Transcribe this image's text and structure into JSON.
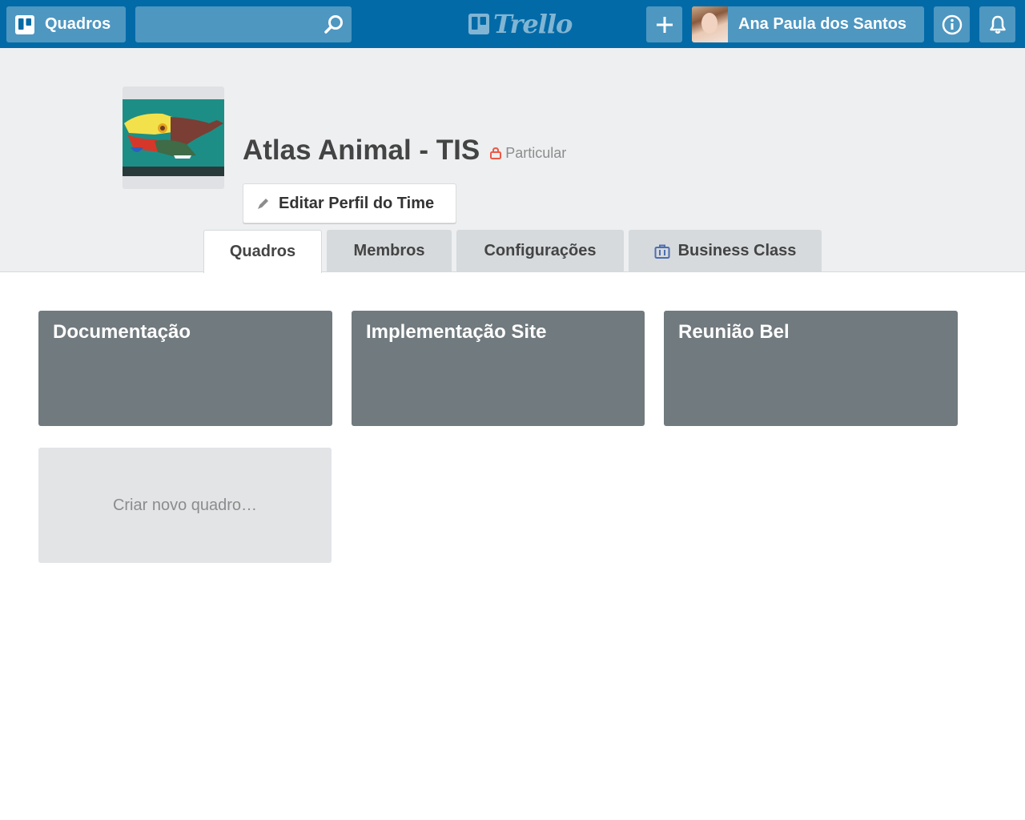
{
  "header": {
    "boards_label": "Quadros",
    "search_placeholder": "",
    "logo_text": "Trello",
    "user_name": "Ana Paula dos Santos",
    "color": "#026aa7"
  },
  "team": {
    "name": "Atlas Animal - TIS",
    "privacy": "Particular",
    "edit_label": "Editar Perfil do Time",
    "privacy_color": "#eb5a46"
  },
  "tabs": [
    {
      "label": "Quadros",
      "active": true
    },
    {
      "label": "Membros",
      "active": false
    },
    {
      "label": "Configurações",
      "active": false
    },
    {
      "label": "Business Class",
      "active": false
    }
  ],
  "boards": [
    {
      "title": "Documentação",
      "color": "#717a7e"
    },
    {
      "title": "Implementação Site",
      "color": "#717a7e"
    },
    {
      "title": "Reunião Bel",
      "color": "#717a7e"
    }
  ],
  "new_board_label": "Criar novo quadro…"
}
